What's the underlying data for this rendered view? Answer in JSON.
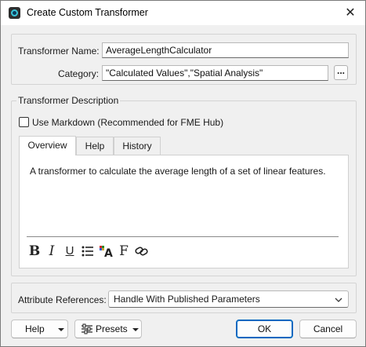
{
  "window": {
    "title": "Create Custom Transformer",
    "close_glyph": "✕"
  },
  "form": {
    "name_label": "Transformer Name:",
    "name_value": "AverageLengthCalculator",
    "category_label": "Category:",
    "category_value": "\"Calculated Values\",\"Spatial Analysis\"",
    "category_browse_label": "..."
  },
  "description": {
    "section_title": "Transformer Description",
    "use_markdown_label": "Use Markdown (Recommended for FME Hub)",
    "use_markdown_checked": false,
    "tabs": [
      {
        "label": "Overview",
        "active": true
      },
      {
        "label": "Help",
        "active": false
      },
      {
        "label": "History",
        "active": false
      }
    ],
    "overview_text": "A transformer to calculate the average length of a set of linear features.",
    "toolbar": [
      {
        "name": "bold",
        "glyph": "B"
      },
      {
        "name": "italic",
        "glyph": "I"
      },
      {
        "name": "underline",
        "glyph": "U"
      },
      {
        "name": "bulleted-list",
        "glyph": "list"
      },
      {
        "name": "font-color",
        "glyph": "A"
      },
      {
        "name": "font",
        "glyph": "F"
      },
      {
        "name": "link",
        "glyph": "link"
      }
    ]
  },
  "attribute_references": {
    "label": "Attribute References:",
    "value": "Handle With Published Parameters"
  },
  "buttons": {
    "help": "Help",
    "presets": "Presets",
    "ok": "OK",
    "cancel": "Cancel"
  },
  "colors": {
    "accent": "#0067c0",
    "app_icon_ring": "#39c6d9",
    "font_color_red": "#d42a2a"
  }
}
